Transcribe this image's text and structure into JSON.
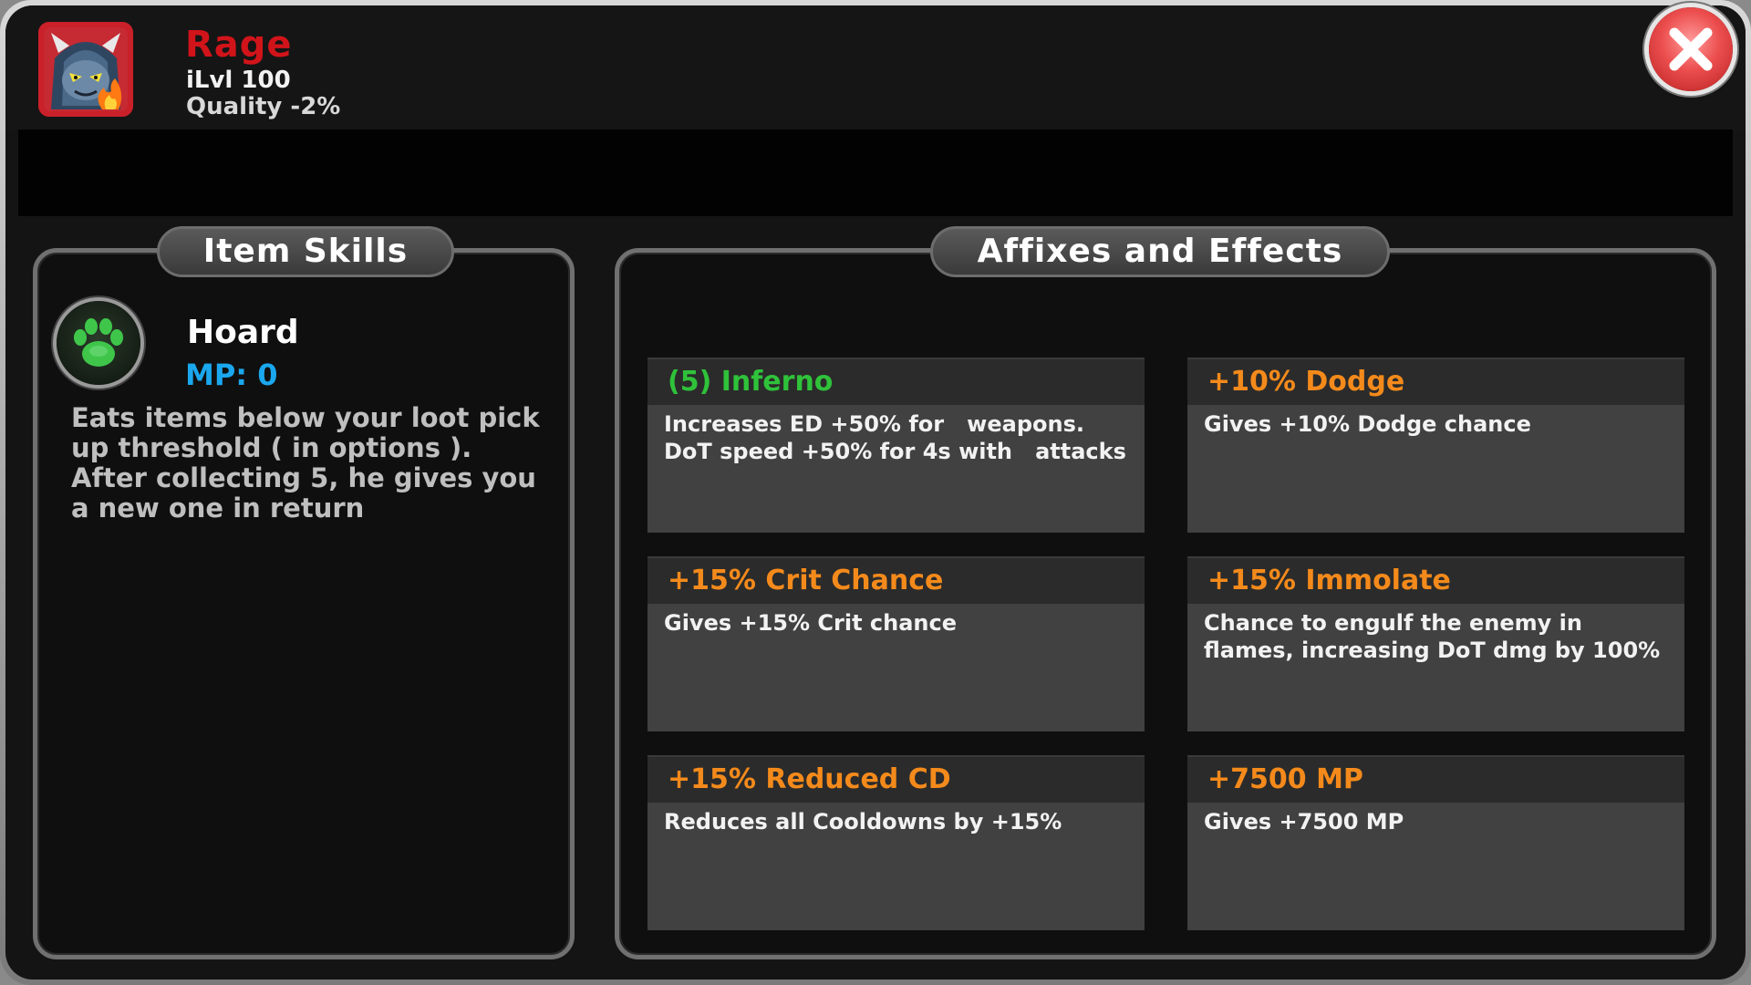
{
  "item": {
    "name": "Rage",
    "level": "iLvl 100",
    "quality": "Quality -2%",
    "portrait_icon": "horned-monster-portrait-icon"
  },
  "close": {
    "icon": "close-x-icon"
  },
  "skills_panel": {
    "title": "Item Skills",
    "skill": {
      "icon": "paw-print-icon",
      "name": "Hoard",
      "mp": "MP: 0",
      "description": "Eats items below your loot pick up threshold ( in options ). After collecting 5, he gives you a new one in return"
    }
  },
  "affixes_panel": {
    "title": "Affixes and Effects",
    "affixes": [
      {
        "title": "(5) Inferno",
        "description": "Increases ED +50% for   weapons. DoT speed +50% for 4s with   attacks"
      },
      {
        "title": "+10% Dodge",
        "description": "Gives +10% Dodge chance"
      },
      {
        "title": "+15% Crit Chance",
        "description": "Gives +15% Crit chance"
      },
      {
        "title": "+15% Immolate",
        "description": "Chance to engulf the enemy in flames, increasing DoT dmg by 100%"
      },
      {
        "title": "+15% Reduced CD",
        "description": "Reduces all Cooldowns by +15%"
      },
      {
        "title": "+7500 MP",
        "description": "Gives +7500 MP"
      }
    ]
  },
  "colors": {
    "item_name": "#d1141a",
    "mp": "#1aa7ee",
    "set_affix": "#2fc23a",
    "affix": "#f48a1b"
  }
}
